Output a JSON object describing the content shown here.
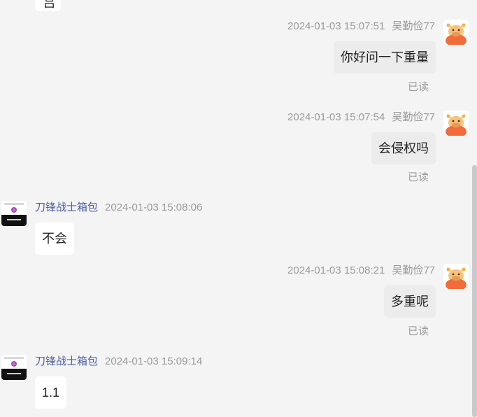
{
  "partial_top_message": {
    "text": "吕"
  },
  "messages": [
    {
      "direction": "out",
      "timestamp": "2024-01-03 15:07:51",
      "sender": "吴勤俭77",
      "text": "你好问一下重量",
      "status": "已读"
    },
    {
      "direction": "out",
      "timestamp": "2024-01-03 15:07:54",
      "sender": "吴勤俭77",
      "text": "会侵权吗",
      "status": "已读"
    },
    {
      "direction": "in",
      "timestamp": "2024-01-03 15:08:06",
      "sender": "刀锋战士箱包",
      "text": "不会"
    },
    {
      "direction": "out",
      "timestamp": "2024-01-03 15:08:21",
      "sender": "吴勤俭77",
      "text": "多重呢",
      "status": "已读"
    },
    {
      "direction": "in",
      "timestamp": "2024-01-03 15:09:14",
      "sender": "刀锋战士箱包",
      "text": "1.1"
    }
  ],
  "colors": {
    "background": "#f4f4f4",
    "bubble_out": "#ececec",
    "bubble_in": "#ffffff",
    "meta_text": "#9a9a9a",
    "seller_name": "#4a5da8",
    "avatar_orange": "#f26b3a"
  },
  "icons": {
    "user_avatar": "cartoon-cow-avatar-icon",
    "seller_avatar": "shop-logo-icon"
  }
}
